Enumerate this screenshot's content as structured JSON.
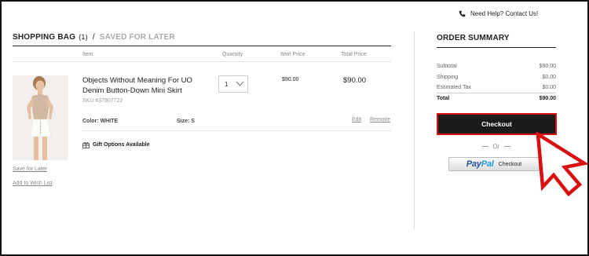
{
  "header": {
    "help_text": "Need Help? Contact Us!"
  },
  "bag": {
    "title": "SHOPPING BAG",
    "count": "(1)",
    "separator": "/",
    "save_for_later_tab": "SAVED FOR LATER",
    "columns": {
      "item": "Item",
      "quantity": "Quantity",
      "item_price": "Item Price",
      "total_price": "Total Price"
    },
    "item": {
      "name": "Objects Without Meaning For UO Denim Button-Down Mini Skirt",
      "sku": "SKU #37907722",
      "quantity": "1",
      "item_price": "$90.00",
      "total_price": "$90.00",
      "color_label": "Color:",
      "color_value": "WHITE",
      "size_label": "Size:",
      "size_value": "S",
      "edit_label": "Edit",
      "remove_label": "Remove",
      "gift_options": "Gift Options Available",
      "save_for_later_link": "Save for Later",
      "add_to_wishlist_link": "Add to Wish List"
    }
  },
  "order_summary": {
    "title": "ORDER SUMMARY",
    "rows": [
      {
        "label": "Subtotal",
        "value": "$90.00"
      },
      {
        "label": "Shipping",
        "value": "$0.00"
      },
      {
        "label": "Estimated Tax",
        "value": "$0.00"
      }
    ],
    "total": {
      "label": "Total",
      "value": "$90.00"
    },
    "checkout_label": "Checkout",
    "or_label": "Or",
    "paypal_brand": [
      "Pay",
      "Pal"
    ],
    "paypal_label": "Checkout"
  },
  "colors": {
    "highlight": "#d81010",
    "button": "#1b1b1b",
    "paypal_blue": "#1f4ea3"
  },
  "icons": {
    "help": "phone-icon",
    "gift": "gift-icon",
    "quantity": "chevron-down-icon",
    "pointer": "arrow-pointer-icon"
  }
}
